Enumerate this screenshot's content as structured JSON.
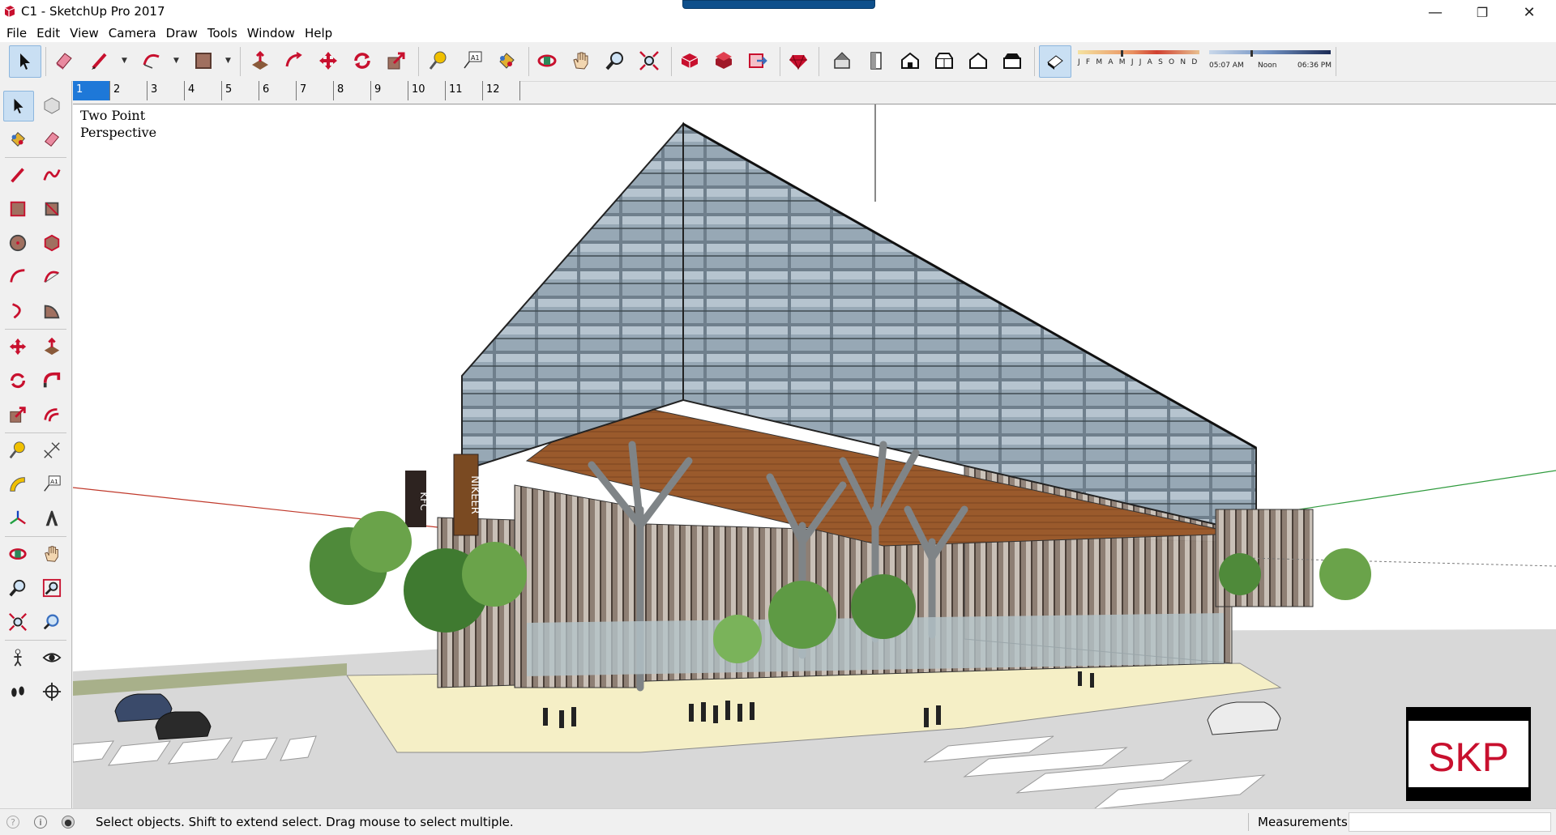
{
  "window": {
    "title": "C1 - SketchUp Pro 2017",
    "minimize": "—",
    "maximize": "❐",
    "close": "✕"
  },
  "menu": [
    "File",
    "Edit",
    "View",
    "Camera",
    "Draw",
    "Tools",
    "Window",
    "Help"
  ],
  "toolbar": {
    "icons": [
      "select-icon",
      "eraser-icon",
      "line-icon",
      "arc-icon",
      "rectangle-icon",
      "push-pull-icon",
      "offset-icon",
      "move-icon",
      "rotate-icon",
      "scale-icon",
      "tape-measure-icon",
      "text-icon",
      "paint-bucket-icon",
      "orbit-icon",
      "pan-icon",
      "zoom-icon",
      "zoom-extents-icon",
      "3d-warehouse-icon",
      "extension-warehouse-icon",
      "send-to-layout-icon",
      "ruby-icon",
      "iso-view-icon",
      "top-view-icon",
      "front-view-icon",
      "right-view-icon",
      "back-view-icon",
      "left-view-icon",
      "shadows-icon"
    ],
    "months": "J F M A M J J A S O N D",
    "time_start": "05:07 AM",
    "time_mid": "Noon",
    "time_end": "06:36 PM",
    "colors": {
      "red": "#c8102e",
      "active_bg": "#c9dff3"
    }
  },
  "scenes": {
    "tabs": [
      "1",
      "2",
      "3",
      "4",
      "5",
      "6",
      "7",
      "8",
      "9",
      "10",
      "11",
      "12"
    ],
    "active": "1"
  },
  "viewport": {
    "camera_line1": "Two Point",
    "camera_line2": "Perspective",
    "storefront_sign_1": "KFC",
    "storefront_sign_2": "NIKEER",
    "watermark": "SKP"
  },
  "status": {
    "message": "Select objects. Shift to extend select. Drag mouse to select multiple.",
    "measurements_label": "Measurements",
    "measurements_value": ""
  }
}
